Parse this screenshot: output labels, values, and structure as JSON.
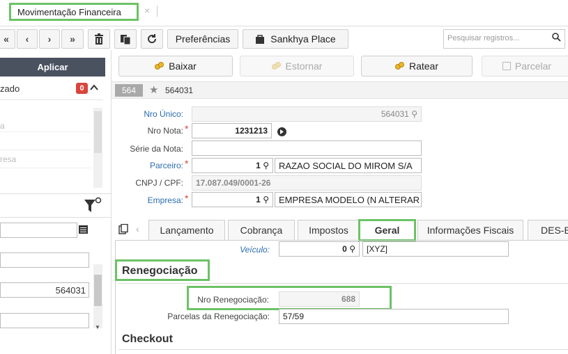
{
  "window_tab": {
    "title": "Movimentação Financeira",
    "close": "×"
  },
  "toolbar": {
    "first": "«",
    "prev": "‹",
    "next": "›",
    "last": "»",
    "preferences_label": "Preferências",
    "sankhya_place_label": "Sankhya Place",
    "search_placeholder": "Pesquisar registros...",
    "colors": {
      "accent_green": "#6cc266",
      "apply_bg": "#4a5260",
      "badge_red": "#d9453c",
      "link_blue": "#2b6cb0"
    }
  },
  "actions": {
    "baixar": "Baixar",
    "estornar": "Estornar",
    "ratear": "Ratear",
    "parcelar": "Parcelar"
  },
  "left_panel": {
    "apply_label": "Aplicar",
    "filter_label": "zado",
    "filter_badge": "0",
    "items": [
      "a",
      "",
      "resa"
    ],
    "field_value": "564031"
  },
  "record": {
    "badge": "564",
    "title": "564031"
  },
  "form": {
    "nro_unico_label": "Nro Único:",
    "nro_unico_value": "564031",
    "nro_nota_label": "Nro Nota:",
    "nro_nota_value": "1231213",
    "serie_label": "Série da Nota:",
    "serie_value": "",
    "parceiro_label": "Parceiro:",
    "parceiro_code": "1",
    "parceiro_name": "RAZAO SOCIAL DO MIROM S/A",
    "cnpj_label": "CNPJ / CPF:",
    "cnpj_value": "17.087.049/0001-26",
    "empresa_label": "Empresa:",
    "empresa_code": "1",
    "empresa_name": "EMPRESA MODELO (N ALTERAR"
  },
  "form_tabs": [
    "Lançamento",
    "Cobrança",
    "Impostos",
    "Geral",
    "Informações Fiscais",
    "DES-B"
  ],
  "geral": {
    "veiculo_label": "Veículo:",
    "veiculo_code": "0",
    "veiculo_name": "[XYZ]",
    "renegociacao_title": "Renegociação",
    "nro_reneg_label": "Nro Renegociação:",
    "nro_reneg_value": "688",
    "parcelas_label": "Parcelas da Renegociação:",
    "parcelas_value": "57/59",
    "checkout_title": "Checkout"
  }
}
